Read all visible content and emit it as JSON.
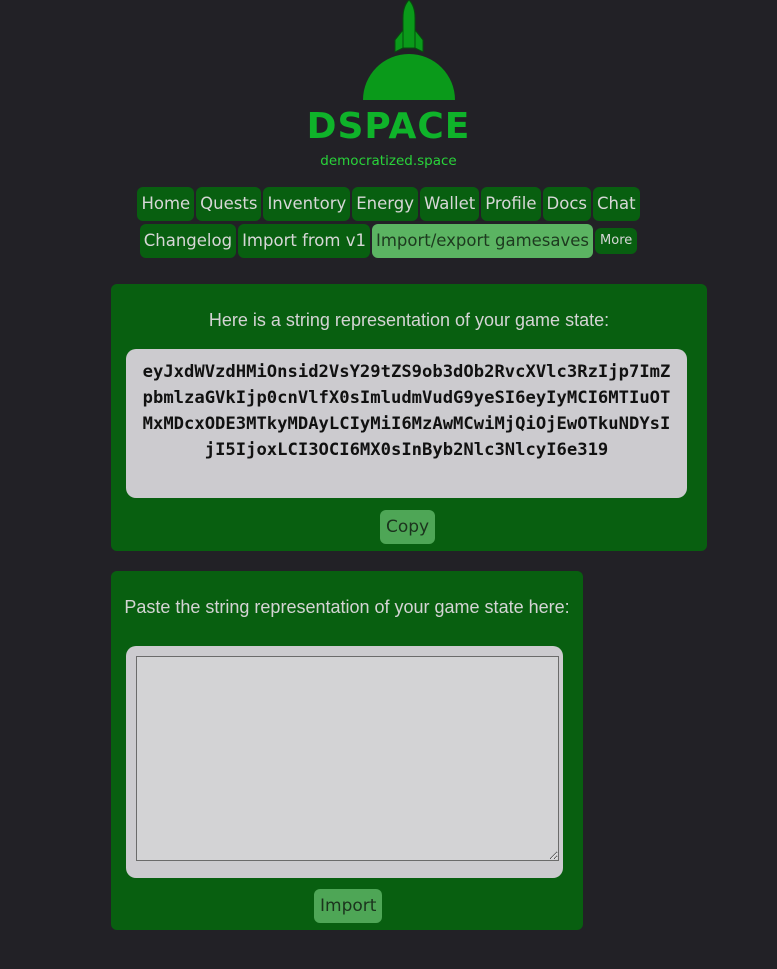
{
  "brand": {
    "logo_icon": "rocket-planet-icon",
    "name": "DSPACE",
    "tagline": "democratized.space",
    "accent_color": "#0fb32a"
  },
  "nav": {
    "row1": [
      {
        "label": "Home",
        "active": false
      },
      {
        "label": "Quests",
        "active": false
      },
      {
        "label": "Inventory",
        "active": false
      },
      {
        "label": "Energy",
        "active": false
      },
      {
        "label": "Wallet",
        "active": false
      },
      {
        "label": "Profile",
        "active": false
      },
      {
        "label": "Docs",
        "active": false
      },
      {
        "label": "Chat",
        "active": false
      }
    ],
    "row2": [
      {
        "label": "Changelog",
        "active": false
      },
      {
        "label": "Import from v1",
        "active": false
      },
      {
        "label": "Import/export gamesaves",
        "active": true
      },
      {
        "label": "More",
        "active": false
      }
    ]
  },
  "export_panel": {
    "heading": "Here is a string representation of your game state:",
    "game_state_string": "eyJxdWVzdHMiOnsid2VsY29tZS9ob3dOb2RvcXVlc3RzIjp7ImZpbmlzaGVkIjp0cnVlfX0sImludmVudG9yeSI6eyIyMCI6MTIuOTMxMDcxODE3MTkyMDAyLCIyMiI6MzAwMCwiMjQiOjEwOTkuNDYsIjI5IjoxLCI3OCI6MX0sInByb2Nlc3NlcyI6e319",
    "copy_label": "Copy"
  },
  "import_panel": {
    "heading": "Paste the string representation of your game state here:",
    "textarea_value": "",
    "textarea_placeholder": "",
    "import_label": "Import"
  },
  "colors": {
    "background": "#222126",
    "panel": "#085f10",
    "nav_button": "#085f10",
    "nav_button_active": "#5bb462",
    "string_box": "#cccbcf"
  }
}
